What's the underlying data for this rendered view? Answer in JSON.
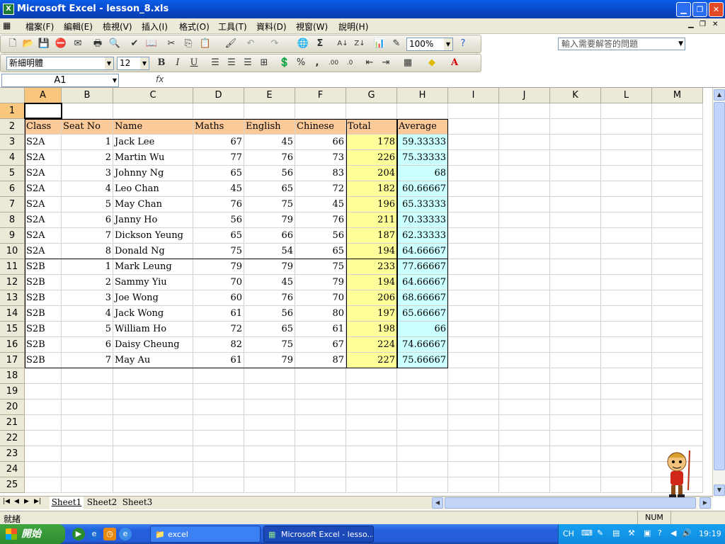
{
  "window": {
    "title": "Microsoft Excel - lesson_8.xls",
    "icon": "excel-icon"
  },
  "menu": {
    "items": [
      "檔案(F)",
      "編輯(E)",
      "檢視(V)",
      "插入(I)",
      "格式(O)",
      "工具(T)",
      "資料(D)",
      "視窗(W)",
      "說明(H)"
    ],
    "help_placeholder": "輸入需要解答的問題"
  },
  "toolbar": {
    "zoom": "100%",
    "font_name": "新細明體",
    "font_size": "12"
  },
  "formula": {
    "name_box": "A1",
    "fx": "fx",
    "content": ""
  },
  "columns": [
    "A",
    "B",
    "C",
    "D",
    "E",
    "F",
    "G",
    "H",
    "I",
    "J",
    "K",
    "L",
    "M"
  ],
  "rows": [
    "1",
    "2",
    "3",
    "4",
    "5",
    "6",
    "7",
    "8",
    "9",
    "10",
    "11",
    "12",
    "13",
    "14",
    "15",
    "16",
    "17",
    "18",
    "19",
    "20",
    "21",
    "22",
    "23",
    "24",
    "25"
  ],
  "table": {
    "headers": [
      "Class",
      "Seat No",
      "Name",
      "Maths",
      "English",
      "Chinese",
      "Total",
      "Average"
    ],
    "data": [
      [
        "S2A",
        "1",
        "Jack Lee",
        "67",
        "45",
        "66",
        "178",
        "59.33333"
      ],
      [
        "S2A",
        "2",
        "Martin Wu",
        "77",
        "76",
        "73",
        "226",
        "75.33333"
      ],
      [
        "S2A",
        "3",
        "Johnny Ng",
        "65",
        "56",
        "83",
        "204",
        "68"
      ],
      [
        "S2A",
        "4",
        "Leo Chan",
        "45",
        "65",
        "72",
        "182",
        "60.66667"
      ],
      [
        "S2A",
        "5",
        "May Chan",
        "76",
        "75",
        "45",
        "196",
        "65.33333"
      ],
      [
        "S2A",
        "6",
        "Janny Ho",
        "56",
        "79",
        "76",
        "211",
        "70.33333"
      ],
      [
        "S2A",
        "7",
        "Dickson Yeung",
        "65",
        "66",
        "56",
        "187",
        "62.33333"
      ],
      [
        "S2A",
        "8",
        "Donald Ng",
        "75",
        "54",
        "65",
        "194",
        "64.66667"
      ],
      [
        "S2B",
        "1",
        "Mark Leung",
        "79",
        "79",
        "75",
        "233",
        "77.66667"
      ],
      [
        "S2B",
        "2",
        "Sammy Yiu",
        "70",
        "45",
        "79",
        "194",
        "64.66667"
      ],
      [
        "S2B",
        "3",
        "Joe Wong",
        "60",
        "76",
        "70",
        "206",
        "68.66667"
      ],
      [
        "S2B",
        "4",
        "Jack Wong",
        "61",
        "56",
        "80",
        "197",
        "65.66667"
      ],
      [
        "S2B",
        "5",
        "William Ho",
        "72",
        "65",
        "61",
        "198",
        "66"
      ],
      [
        "S2B",
        "6",
        "Daisy Cheung",
        "82",
        "75",
        "67",
        "224",
        "74.66667"
      ],
      [
        "S2B",
        "7",
        "May Au",
        "61",
        "79",
        "87",
        "227",
        "75.66667"
      ]
    ]
  },
  "sheets": [
    "Sheet1",
    "Sheet2",
    "Sheet3"
  ],
  "status": {
    "left": "就緒",
    "num": "NUM"
  },
  "taskbar": {
    "start_label": "開始",
    "tasks": [
      "excel",
      "Microsoft Excel - lesso..."
    ],
    "tray_lang": "CH",
    "clock": "19:19"
  },
  "colors": {
    "header_fill": "#fcc999",
    "total_fill": "#ffff99",
    "average_fill": "#ccffff",
    "selection": "#f8c77d"
  }
}
